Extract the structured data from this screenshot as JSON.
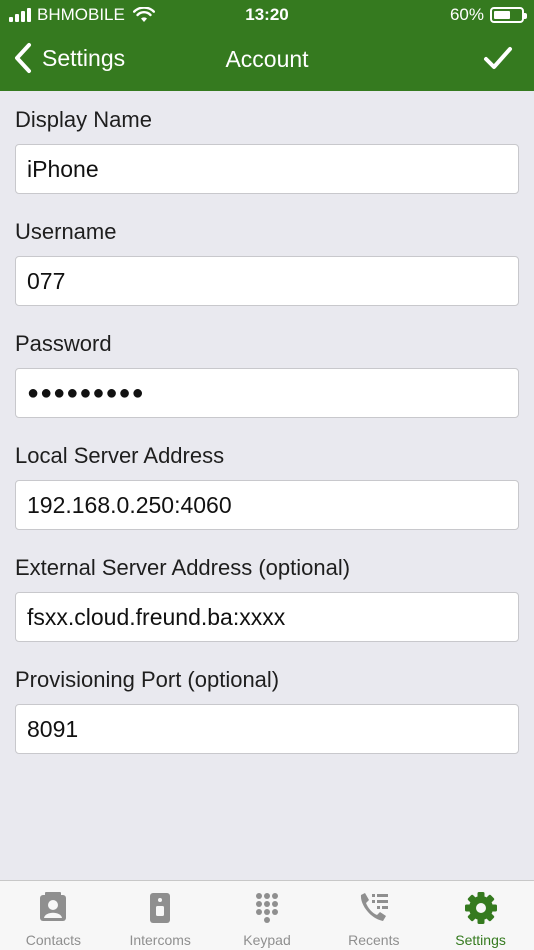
{
  "status_bar": {
    "carrier": "BHMOBILE",
    "time": "13:20",
    "battery": "60%",
    "battery_level": 0.6
  },
  "nav": {
    "back_label": "Settings",
    "title": "Account"
  },
  "fields": [
    {
      "label": "Display Name",
      "value": "iPhone"
    },
    {
      "label": "Username",
      "value": "077"
    },
    {
      "label": "Password",
      "value": "●●●●●●●●●"
    },
    {
      "label": "Local Server Address",
      "value": "192.168.0.250:4060"
    },
    {
      "label": "External Server Address (optional)",
      "value": "fsxx.cloud.freund.ba:xxxx"
    },
    {
      "label": "Provisioning Port (optional)",
      "value": "8091"
    }
  ],
  "tabs": [
    {
      "label": "Contacts",
      "icon": "contact-card-icon"
    },
    {
      "label": "Intercoms",
      "icon": "intercom-icon"
    },
    {
      "label": "Keypad",
      "icon": "keypad-icon"
    },
    {
      "label": "Recents",
      "icon": "recents-phone-icon"
    },
    {
      "label": "Settings",
      "icon": "gear-icon",
      "active": true
    }
  ],
  "colors": {
    "accent": "#357a1f",
    "background": "#e9e9ef",
    "tab_inactive": "#8f8f8f"
  }
}
